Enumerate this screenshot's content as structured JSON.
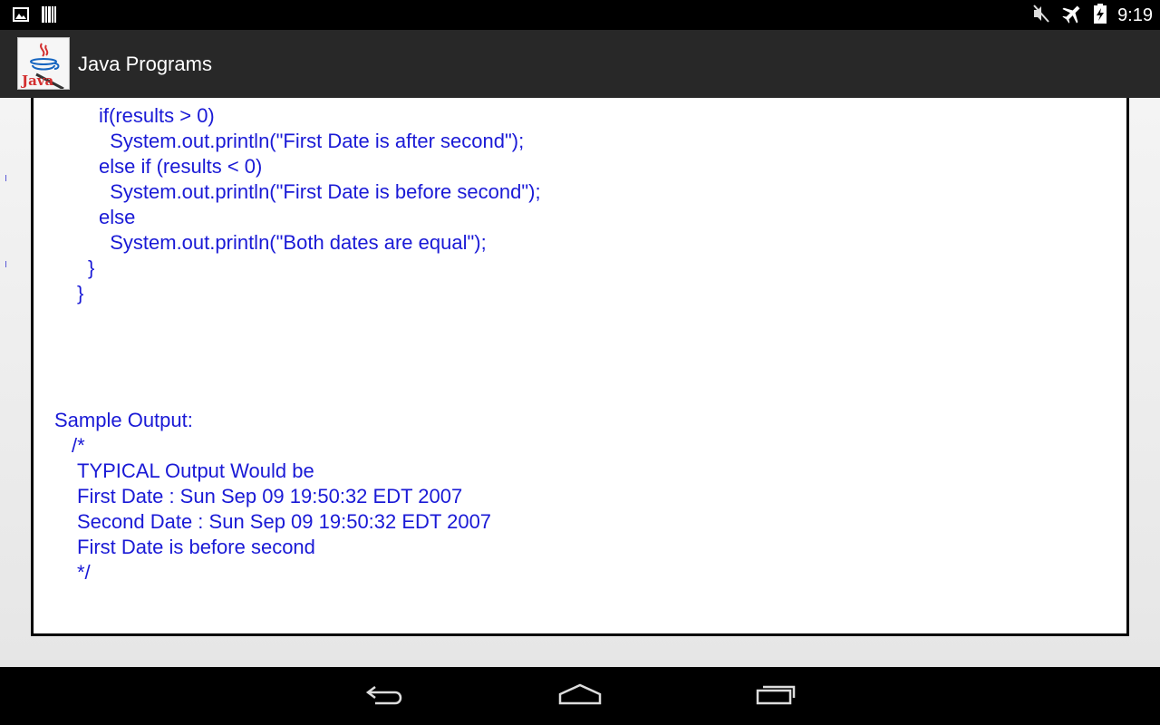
{
  "status_bar": {
    "time": "9:19",
    "left_icons": [
      "image-icon",
      "barcode-icon"
    ],
    "right_icons": [
      "mute-icon",
      "airplane-icon",
      "battery-charging-icon"
    ]
  },
  "action_bar": {
    "app_icon": "java-logo-icon",
    "app_icon_text": "Java",
    "title": "Java Programs"
  },
  "code": {
    "lines": [
      "if(results > 0)",
      "  System.out.println(\"First Date is after second\");",
      "else if (results < 0)",
      "  System.out.println(\"First Date is before second\");",
      "else",
      "  System.out.println(\"Both dates are equal\");",
      "}",
      "}"
    ]
  },
  "output": {
    "heading": "Sample Output:",
    "lines": [
      "/*",
      "TYPICAL Output Would be",
      "First Date : Sun Sep 09 19:50:32 EDT 2007",
      "Second Date : Sun Sep 09 19:50:32 EDT 2007",
      "First Date is before second",
      "*/"
    ]
  },
  "nav_bar": {
    "buttons": [
      "back-icon",
      "home-icon",
      "recent-apps-icon"
    ]
  },
  "colors": {
    "code_text": "#1a1ad6",
    "action_bar": "#282828",
    "status_bar": "#000000"
  }
}
